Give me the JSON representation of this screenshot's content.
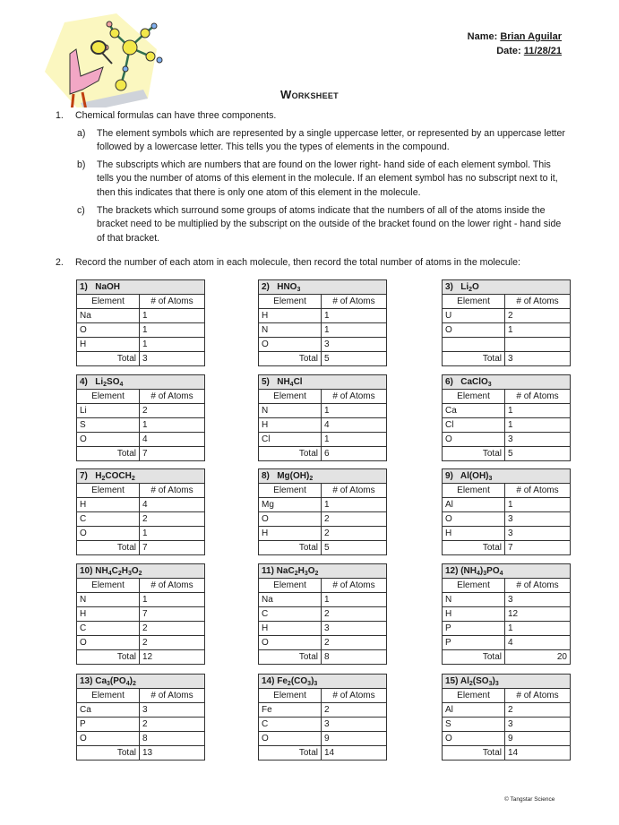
{
  "header": {
    "name_label": "Name:",
    "name_value": "Brian Aguilar",
    "date_label": "Date:",
    "date_value": "11/28/21"
  },
  "title": "Worksheet",
  "question1": {
    "number": "1.",
    "lead": "Chemical formulas can have three components.",
    "items": [
      {
        "label": "a)",
        "text": "The element symbols which are represented by a single uppercase letter, or represented by an uppercase letter followed by a lowercase letter.  This tells you the types of elements in the compound."
      },
      {
        "label": "b)",
        "text": "The subscripts which are numbers that are found on the lower right- hand side of each element symbol.  This tells you the number of atoms of this element in the molecule.  If an element symbol has no subscript next to it, then this indicates that there is only one atom of this element in the molecule."
      },
      {
        "label": "c)",
        "text": "The brackets  which surround some groups of atoms indicate that the numbers of all of the atoms inside the bracket need to be multiplied by the subscript on the outside of the bracket found on the lower right - hand side of that bracket."
      }
    ]
  },
  "question2": {
    "number": "2.",
    "text": "Record the number of each atom in each molecule, then record the total number of atoms in the molecule:"
  },
  "table_labels": {
    "element": "Element",
    "atoms": "# of Atoms",
    "total": "Total"
  },
  "tables": [
    {
      "title_html": "1)&nbsp;&nbsp; NaOH",
      "rows": [
        [
          "Na",
          "1"
        ],
        [
          "O",
          "1"
        ],
        [
          "H",
          "1"
        ]
      ],
      "total": "3"
    },
    {
      "title_html": "2)&nbsp;&nbsp; HNO<sub>3</sub>",
      "rows": [
        [
          "H",
          "1"
        ],
        [
          "N",
          "1"
        ],
        [
          "O",
          "3"
        ]
      ],
      "total": "5"
    },
    {
      "title_html": "3)&nbsp;&nbsp; Li<sub>2</sub>O",
      "rows": [
        [
          "U",
          "2"
        ],
        [
          "O",
          "1"
        ],
        [
          "",
          ""
        ]
      ],
      "total": "3"
    },
    {
      "title_html": "4)&nbsp;&nbsp; Li<sub>2</sub>SO<sub>4</sub>",
      "rows": [
        [
          "Li",
          "2"
        ],
        [
          "S",
          "1"
        ],
        [
          "O",
          "4"
        ]
      ],
      "total": "7"
    },
    {
      "title_html": "5)&nbsp;&nbsp; NH<sub>4</sub>Cl",
      "rows": [
        [
          "N",
          "1"
        ],
        [
          "H",
          "4"
        ],
        [
          "Cl",
          "1"
        ]
      ],
      "total": "6"
    },
    {
      "title_html": "6)&nbsp;&nbsp; CaClO<sub>3</sub>",
      "rows": [
        [
          "Ca",
          "1"
        ],
        [
          "Cl",
          "1"
        ],
        [
          "O",
          "3"
        ]
      ],
      "total": "5"
    },
    {
      "title_html": "7)&nbsp;&nbsp; H<sub>2</sub>COCH<sub>2</sub>",
      "rows": [
        [
          "H",
          "4"
        ],
        [
          "C",
          "2"
        ],
        [
          "O",
          "1"
        ]
      ],
      "total": "7"
    },
    {
      "title_html": "8)&nbsp;&nbsp; Mg(OH)<sub>2</sub>",
      "rows": [
        [
          "Mg",
          "1"
        ],
        [
          "O",
          "2"
        ],
        [
          "H",
          "2"
        ]
      ],
      "total": "5"
    },
    {
      "title_html": "9)&nbsp;&nbsp; Al(OH)<sub>3</sub>",
      "rows": [
        [
          "Al",
          "1"
        ],
        [
          "O",
          "3"
        ],
        [
          "H",
          "3"
        ]
      ],
      "total": "7"
    },
    {
      "title_html": "10) NH<sub>4</sub>C<sub>2</sub>H<sub>3</sub>O<sub>2</sub>",
      "rows": [
        [
          "N",
          "1"
        ],
        [
          "H",
          "7"
        ],
        [
          "C",
          "2"
        ],
        [
          "O",
          "2"
        ]
      ],
      "total": "12"
    },
    {
      "title_html": "11) NaC<sub>2</sub>H<sub>3</sub>O<sub>2</sub>",
      "rows": [
        [
          "Na",
          "1"
        ],
        [
          "C",
          "2"
        ],
        [
          "H",
          "3"
        ],
        [
          "O",
          "2"
        ]
      ],
      "total": "8"
    },
    {
      "title_html": "12) (NH<sub>4</sub>)<sub>3</sub>PO<sub>4</sub>",
      "rows": [
        [
          "N",
          "3"
        ],
        [
          "H",
          "12"
        ],
        [
          "P",
          "1"
        ],
        [
          "P",
          "4"
        ]
      ],
      "total": "20",
      "total_align": "right"
    },
    {
      "title_html": "13) Ca<sub>3</sub>(PO<sub>4</sub>)<sub>2</sub>",
      "rows": [
        [
          "Ca",
          "3"
        ],
        [
          "P",
          "2"
        ],
        [
          "O",
          "8"
        ]
      ],
      "total": "13"
    },
    {
      "title_html": "14) Fe<sub>2</sub>(CO<sub>3</sub>)<sub>3</sub>",
      "rows": [
        [
          "Fe",
          "2"
        ],
        [
          "C",
          "3"
        ],
        [
          "O",
          "9"
        ]
      ],
      "total": "14"
    },
    {
      "title_html": "15) Al<sub>2</sub>(SO<sub>3</sub>)<sub>3</sub>",
      "rows": [
        [
          "Al",
          "2"
        ],
        [
          "S",
          "3"
        ],
        [
          "O",
          "9"
        ]
      ],
      "total": "14"
    }
  ],
  "footer": "© Tangstar Science"
}
